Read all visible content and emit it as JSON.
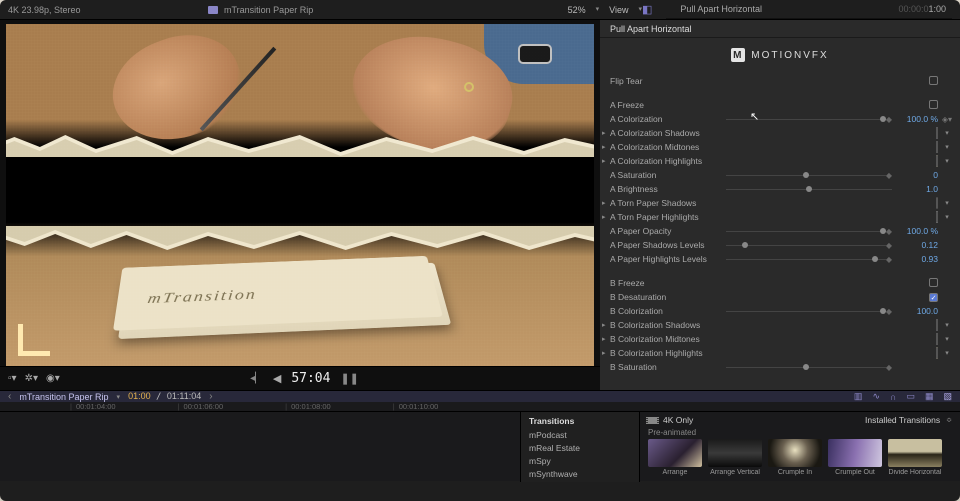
{
  "topbar": {
    "format": "4K 23.98p, Stereo",
    "project": "mTransition Paper Rip",
    "zoom": "52%",
    "view_label": "View"
  },
  "inspector_titlebar": {
    "name": "Pull Apart Horizontal",
    "duration_dim": "00:00:0",
    "duration_active": "1:00"
  },
  "inspector": {
    "header": "Pull Apart Horizontal",
    "brand": "MOTIONVFX",
    "flip_tear_label": "Flip Tear",
    "a": {
      "freeze": {
        "label": "A Freeze",
        "checked": false
      },
      "colorization": {
        "label": "A Colorization",
        "value": "100.0",
        "unit": "%"
      },
      "shadows": {
        "label": "A Colorization Shadows",
        "swatch": "#8a87a3"
      },
      "midtones": {
        "label": "A Colorization Midtones",
        "swatch": "#8f8f8f"
      },
      "highlights": {
        "label": "A Colorization Highlights",
        "swatch": "#cfc58e"
      },
      "saturation": {
        "label": "A Saturation",
        "value": "0"
      },
      "brightness": {
        "label": "A Brightness",
        "value": "1.0"
      },
      "torn_shadows": {
        "label": "A Torn Paper Shadows",
        "swatch": "#0d0d0d"
      },
      "torn_highlights": {
        "label": "A Torn Paper Highlights",
        "swatch": "#f2f2f2"
      },
      "paper_opacity": {
        "label": "A Paper Opacity",
        "value": "100.0",
        "unit": "%"
      },
      "paper_shadows_lvl": {
        "label": "A Paper Shadows Levels",
        "value": "0.12"
      },
      "paper_highlights_lvl": {
        "label": "A Paper Highlights Levels",
        "value": "0.93"
      }
    },
    "b": {
      "freeze": {
        "label": "B Freeze",
        "checked": false
      },
      "desaturation": {
        "label": "B Desaturation",
        "checked": true
      },
      "colorization": {
        "label": "B Colorization",
        "value": "100.0"
      },
      "shadows": {
        "label": "B Colorization Shadows",
        "swatch": "#8a87a3"
      },
      "midtones": {
        "label": "B Colorization Midtones",
        "swatch": "#8f8f8f"
      },
      "highlights": {
        "label": "B Colorization Highlights",
        "swatch": "#cfc58e"
      },
      "saturation": {
        "label": "B Saturation"
      }
    }
  },
  "viewer": {
    "card_text": "mTransition",
    "timecode": "57:04"
  },
  "timeline": {
    "title": "mTransition Paper Rip",
    "tc_current": "01:00",
    "tc_total": "01:11:04",
    "ruler": [
      "00:01:04:00",
      "00:01:06:00",
      "00:01:08:00",
      "00:01:10:00"
    ],
    "category_header": "Transitions",
    "categories": [
      "mPodcast",
      "mReal Estate",
      "mSpy",
      "mSynthwave"
    ],
    "browser": {
      "filter": "4K Only",
      "set_label": "Installed Transitions",
      "group": "Pre-animated",
      "thumbs": [
        "Arrange",
        "Arrange Vertical",
        "Crumple In",
        "Crumple Out",
        "Divide Horizontal"
      ]
    }
  }
}
